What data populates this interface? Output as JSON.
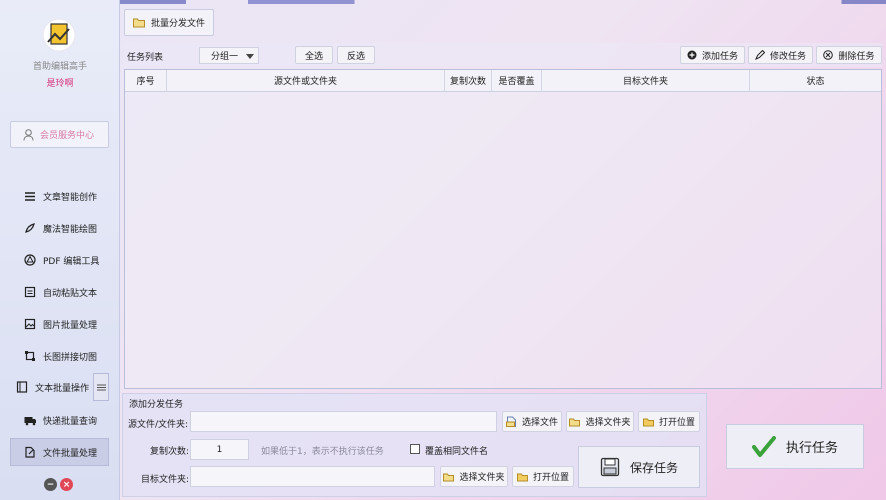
{
  "sidebar": {
    "app_name": "首助编辑高手",
    "user_name": "是玲啊",
    "member_label": "会员服务中心",
    "items": [
      {
        "label": "文章智能创作",
        "icon": "lines-icon"
      },
      {
        "label": "魔法智能绘图",
        "icon": "brush-icon"
      },
      {
        "label": "PDF 编辑工具",
        "icon": "pdf-icon"
      },
      {
        "label": "自动粘贴文本",
        "icon": "paste-icon"
      },
      {
        "label": "图片批量处理",
        "icon": "image-icon"
      },
      {
        "label": "长图拼接切图",
        "icon": "crop-icon"
      },
      {
        "label": "文本批量操作",
        "icon": "text-icon"
      },
      {
        "label": "快递批量查询",
        "icon": "truck-icon"
      },
      {
        "label": "文件批量处理",
        "icon": "file-edit-icon"
      }
    ],
    "active_index": 8
  },
  "main": {
    "tab_label": "批量分发文件",
    "task_list_label": "任务列表",
    "group_value": "分组一",
    "select_all": "全选",
    "invert_select": "反选",
    "add_task": "添加任务",
    "edit_task": "修改任务",
    "delete_task": "删除任务",
    "columns": [
      "序号",
      "源文件或文件夹",
      "复制次数",
      "是否覆盖",
      "目标文件夹",
      "状态"
    ]
  },
  "add_panel": {
    "title": "添加分发任务",
    "source_label": "源文件/文件夹:",
    "source_value": "",
    "select_file": "选择文件",
    "select_folder": "选择文件夹",
    "open_location": "打开位置",
    "copies_label": "复制次数:",
    "copies_value": "1",
    "copies_hint": "如果低于1，表示不执行该任务",
    "overwrite_label": "覆盖相同文件名",
    "overwrite_checked": false,
    "target_label": "目标文件夹:",
    "target_value": "",
    "target_select_folder": "选择文件夹",
    "target_open_location": "打开位置",
    "save_task": "保存任务"
  },
  "execute_task": "执行任务",
  "colors": {
    "accent_pink": "#d6307a",
    "check_green": "#3aa23a",
    "close_red": "#e04858"
  }
}
